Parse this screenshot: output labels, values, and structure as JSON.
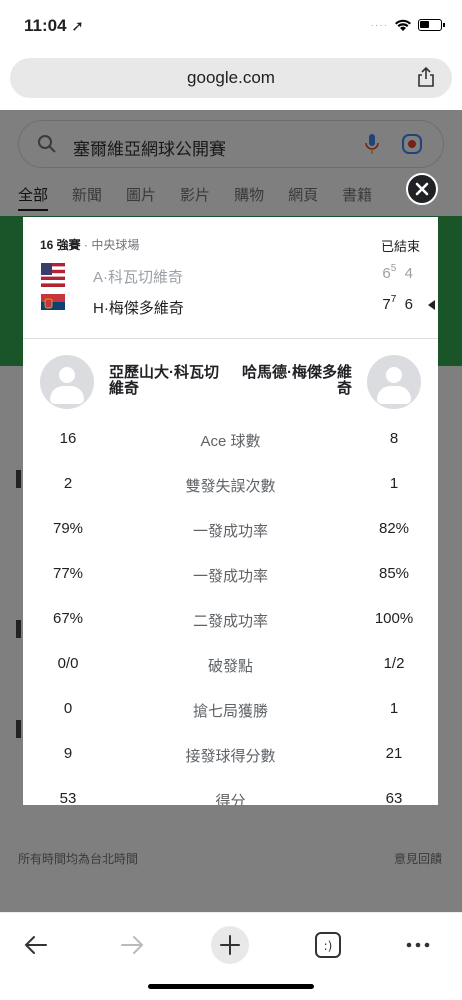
{
  "status_bar": {
    "time": "11:04",
    "location_glyph": "➚"
  },
  "browser": {
    "url": "google.com"
  },
  "search": {
    "query": "塞爾維亞網球公開賽"
  },
  "tabs": [
    "全部",
    "新聞",
    "圖片",
    "影片",
    "購物",
    "網頁",
    "書籍"
  ],
  "footer": {
    "timezone_note": "所有時間均為台北時間",
    "feedback": "意見回饋"
  },
  "match": {
    "round": "16 強賽",
    "court": "中央球場",
    "status": "已結束",
    "players": [
      {
        "name": "A·科瓦切維奇",
        "flag": "us-flag",
        "set1": "6",
        "set1_tb": "5",
        "set2": "4",
        "winner": false
      },
      {
        "name": "H·梅傑多維奇",
        "flag": "serbia-flag",
        "set1": "7",
        "set1_tb": "7",
        "set2": "6",
        "winner": true
      }
    ],
    "full_names": {
      "left": "亞歷山大·科瓦切維奇",
      "right": "哈馬德·梅傑多維奇"
    },
    "stats": [
      {
        "left": "16",
        "label": "Ace 球數",
        "right": "8"
      },
      {
        "left": "2",
        "label": "雙發失誤次數",
        "right": "1"
      },
      {
        "left": "79%",
        "label": "一發成功率",
        "right": "82%"
      },
      {
        "left": "77%",
        "label": "一發成功率",
        "right": "85%"
      },
      {
        "left": "67%",
        "label": "二發成功率",
        "right": "100%"
      },
      {
        "left": "0/0",
        "label": "破發點",
        "right": "1/2"
      },
      {
        "left": "0",
        "label": "搶七局獲勝",
        "right": "1"
      },
      {
        "left": "9",
        "label": "接發球得分數",
        "right": "21"
      },
      {
        "left": "53",
        "label": "得分",
        "right": "63"
      }
    ]
  },
  "colors": {
    "accent_green": "#34a853",
    "dark": "#202124",
    "muted": "#9aa0a6"
  }
}
